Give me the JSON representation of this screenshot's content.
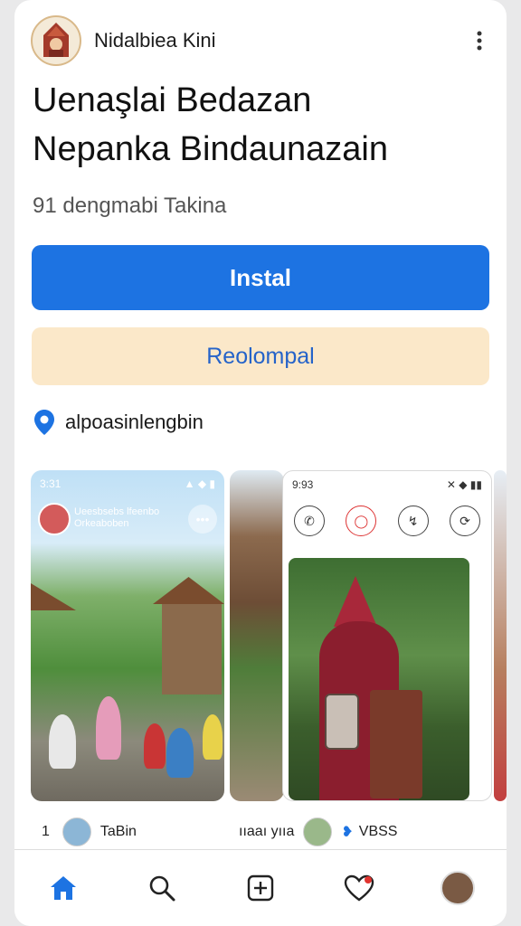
{
  "app": {
    "name": "Nidalbiea Kini"
  },
  "title_lines": [
    "Uenaşlai Bedazan",
    "Nepanka Bindaunazain"
  ],
  "meta_text": "91 dengmabi Takina",
  "buttons": {
    "install": "Instal",
    "secondary": "Reolompal"
  },
  "location": {
    "text": "alpoasinlengbin"
  },
  "screens": {
    "s1": {
      "time": "3:31",
      "story_text": "Ueesbsebs lfeenbo Orkeaboben"
    },
    "s3": {
      "time": "9:93"
    }
  },
  "bottom_row": {
    "left_count": "1",
    "left_label": "TaBin",
    "mid_label": "ııaaı yııa",
    "right_label": "VBSS"
  },
  "nav": {
    "items": [
      "home-icon",
      "search-icon",
      "create-icon",
      "heart-icon",
      "profile-avatar"
    ]
  },
  "colors": {
    "accent": "#1d73e2",
    "secondary_bg": "#fbe8c9",
    "secondary_text": "#2563c9"
  }
}
